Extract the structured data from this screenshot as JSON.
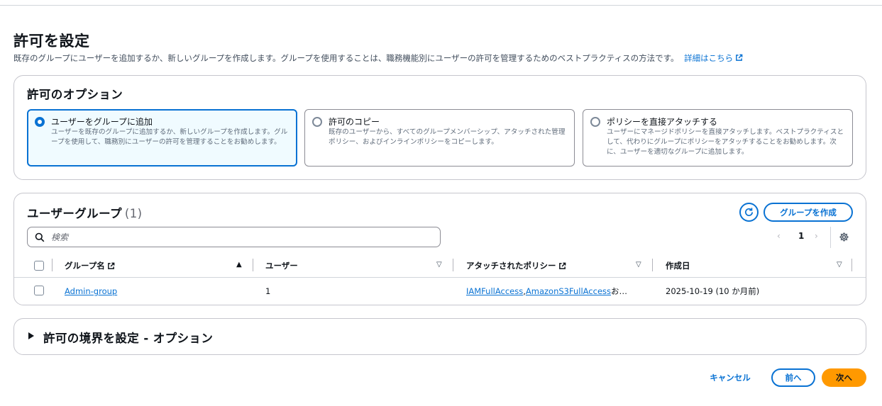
{
  "page": {
    "title": "許可を設定",
    "description": "既存のグループにユーザーを追加するか、新しいグループを作成します。グループを使用することは、職務機能別にユーザーの許可を管理するためのベストプラクティスの方法です。",
    "learn_more": "詳細はこちら"
  },
  "options": {
    "heading": "許可のオプション",
    "items": [
      {
        "label": "ユーザーをグループに追加",
        "desc": "ユーザーを既存のグループに追加するか、新しいグループを作成します。グループを使用して、職務別にユーザーの許可を管理することをお勧めします。",
        "selected": true
      },
      {
        "label": "許可のコピー",
        "desc": "既存のユーザーから、すべてのグループメンバーシップ、アタッチされた管理ポリシー、およびインラインポリシーをコピーします。",
        "selected": false
      },
      {
        "label": "ポリシーを直接アタッチする",
        "desc": "ユーザーにマネージドポリシーを直接アタッチします。ベストプラクティスとして、代わりにグループにポリシーをアタッチすることをお勧めします。次に、ユーザーを適切なグループに追加します。",
        "selected": false
      }
    ]
  },
  "groups": {
    "heading": "ユーザーグループ",
    "count": "(1)",
    "create_label": "グループを作成",
    "search_placeholder": "検索",
    "pagination": {
      "prev": "‹",
      "current": "1",
      "next": "›"
    },
    "columns": {
      "name": "グループ名",
      "users": "ユーザー",
      "policies": "アタッチされたポリシー",
      "created": "作成日"
    },
    "rows": [
      {
        "name": "Admin-group",
        "users": "1",
        "policy_1": "IAMFullAccess",
        "policy_sep": ", ",
        "policy_2": "AmazonS3FullAccess",
        "policy_more": " お…",
        "created": "2025-10-19 (10 か月前)"
      }
    ]
  },
  "boundary": {
    "title": "許可の境界を設定 - オプション"
  },
  "footer": {
    "cancel": "キャンセル",
    "previous": "前へ",
    "next": "次へ"
  },
  "colors": {
    "accent": "#0972d3",
    "primary_button": "#ff9900"
  }
}
